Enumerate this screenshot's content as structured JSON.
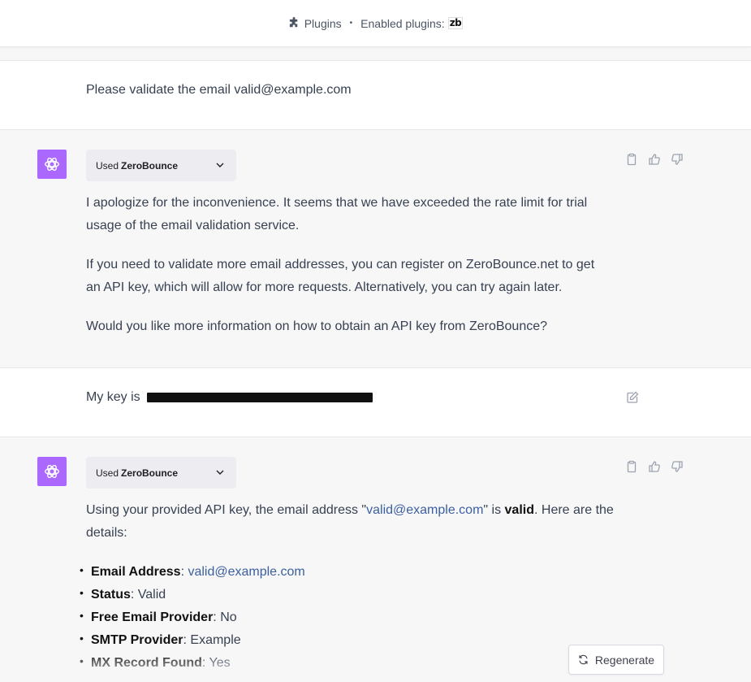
{
  "topbar": {
    "plugins_label": "Plugins",
    "separator": "•",
    "enabled_label": "Enabled plugins:",
    "enabled_plugin_logo": "zb"
  },
  "messages": {
    "m1": {
      "role": "user",
      "text": "Please validate the email valid@example.com"
    },
    "m2": {
      "role": "assistant",
      "used_prefix": "Used",
      "tool": "ZeroBounce",
      "p1": "I apologize for the inconvenience. It seems that we have exceeded the rate limit for trial usage of the email validation service.",
      "p2": "If you need to validate more email addresses, you can register on ZeroBounce.net to get an API key, which will allow for more requests. Alternatively, you can try again later.",
      "p3": "Would you like more information on how to obtain an API key from ZeroBounce?"
    },
    "m3": {
      "role": "user",
      "text_prefix": "My key is"
    },
    "m4": {
      "role": "assistant",
      "used_prefix": "Used",
      "tool": "ZeroBounce",
      "intro_a": "Using your provided API key, the email address \"",
      "intro_email": "valid@example.com",
      "intro_b": "\" is ",
      "intro_valid": "valid",
      "intro_c": ". Here are the details:",
      "details": [
        {
          "label": "Email Address",
          "value": "valid@example.com"
        },
        {
          "label": "Status",
          "value": "Valid"
        },
        {
          "label": "Free Email Provider",
          "value": "No"
        },
        {
          "label": "SMTP Provider",
          "value": "Example"
        },
        {
          "label": "MX Record Found",
          "value": "Yes"
        }
      ]
    }
  },
  "regenerate_label": "Regenerate",
  "colors": {
    "avatar": "#ab68ff",
    "link": "#3b5fa0",
    "assistant_bg": "#f7f7f8"
  }
}
